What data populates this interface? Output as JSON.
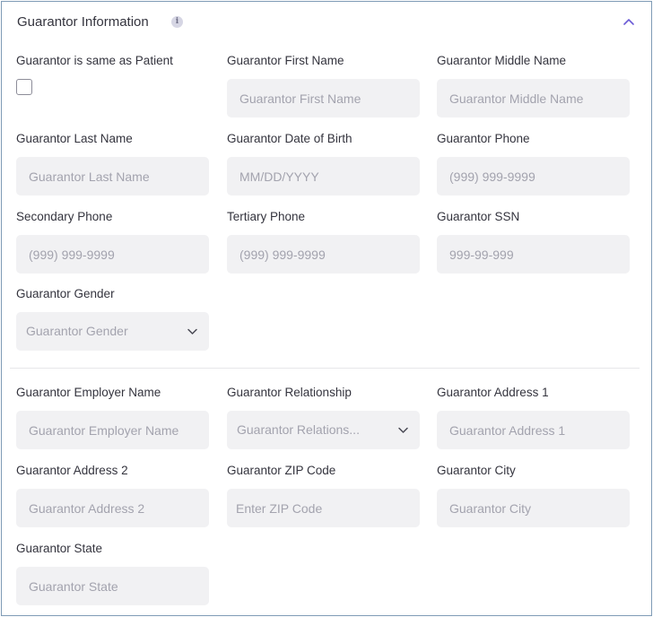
{
  "section": {
    "title": "Guarantor Information",
    "info_icon": "info-icon",
    "collapse_icon": "chevron-up-icon",
    "accent_color": "#6b5bd6"
  },
  "fields": {
    "same_as_patient": {
      "label": "Guarantor is same as Patient",
      "checked": false
    },
    "first_name": {
      "label": "Guarantor First Name",
      "placeholder": "Guarantor First Name"
    },
    "middle_name": {
      "label": "Guarantor Middle Name",
      "placeholder": "Guarantor Middle Name"
    },
    "last_name": {
      "label": "Guarantor Last Name",
      "placeholder": "Guarantor Last Name"
    },
    "dob": {
      "label": "Guarantor Date of Birth",
      "placeholder": "MM/DD/YYYY"
    },
    "phone": {
      "label": "Guarantor Phone",
      "placeholder": "(999) 999-9999"
    },
    "secondary_phone": {
      "label": "Secondary Phone",
      "placeholder": "(999) 999-9999"
    },
    "tertiary_phone": {
      "label": "Tertiary Phone",
      "placeholder": "(999) 999-9999"
    },
    "ssn": {
      "label": "Guarantor SSN",
      "placeholder": "999-99-999"
    },
    "gender": {
      "label": "Guarantor Gender",
      "placeholder": "Guarantor Gender"
    },
    "employer": {
      "label": "Guarantor Employer Name",
      "placeholder": "Guarantor Employer Name"
    },
    "relationship": {
      "label": "Guarantor Relationship",
      "placeholder": "Guarantor Relations..."
    },
    "address1": {
      "label": "Guarantor Address 1",
      "placeholder": "Guarantor Address 1"
    },
    "address2": {
      "label": "Guarantor Address 2",
      "placeholder": "Guarantor Address 2"
    },
    "zip": {
      "label": "Guarantor ZIP Code",
      "placeholder": "Enter ZIP Code"
    },
    "city": {
      "label": "Guarantor City",
      "placeholder": "Guarantor City"
    },
    "state": {
      "label": "Guarantor State",
      "placeholder": "Guarantor State"
    }
  }
}
